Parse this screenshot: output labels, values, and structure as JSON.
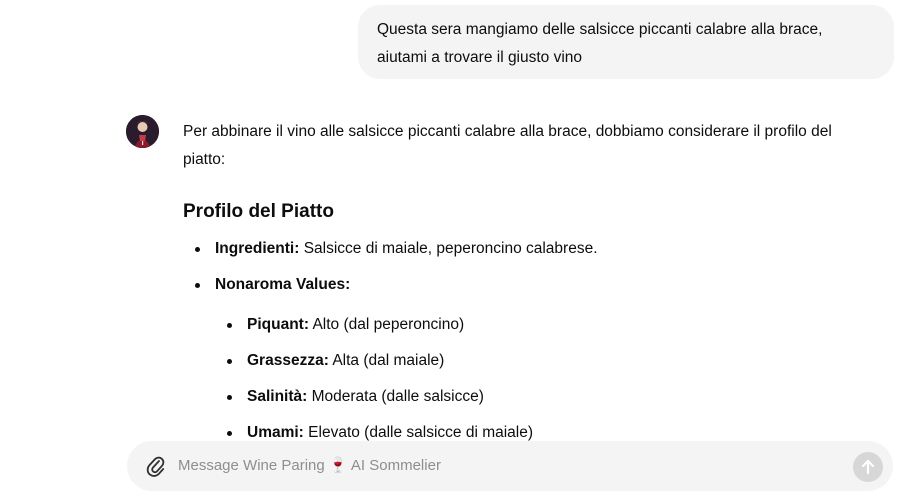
{
  "user_message": {
    "line1": "Questa sera mangiamo delle salsicce piccanti calabre alla brace,",
    "line2": "aiutami a trovare il giusto vino"
  },
  "assistant": {
    "avatar_icon": "wine-sommelier-avatar-icon",
    "intro_line1": "Per abbinare il vino alle salsicce piccanti calabre alla brace, dobbiamo considerare il profilo del",
    "intro_line2": "piatto:",
    "section_title": "Profilo del Piatto",
    "items": [
      {
        "label": "Ingredienti:",
        "text": "Salsicce di maiale, peperoncino calabrese."
      },
      {
        "label": "Nonaroma Values:",
        "text": ""
      }
    ],
    "sub_items": [
      {
        "label": "Piquant:",
        "text": "Alto (dal peperoncino)"
      },
      {
        "label": "Grassezza:",
        "text": "Alta (dal maiale)"
      },
      {
        "label": "Salinità:",
        "text": "Moderata (dalle salsicce)"
      },
      {
        "label": "Umami:",
        "text": "Elevato (dalle salsicce di maiale)"
      }
    ]
  },
  "composer": {
    "placeholder": "Message Wine Paring 🍷 AI Sommelier",
    "attach_icon": "paperclip-icon",
    "send_icon": "arrow-up-icon"
  }
}
